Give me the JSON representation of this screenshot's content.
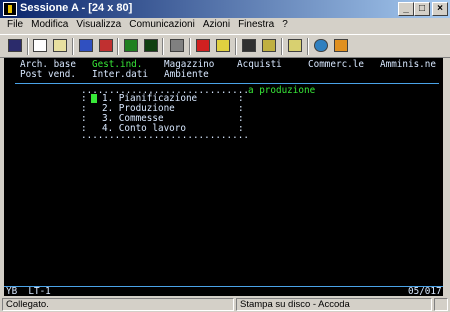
{
  "window": {
    "title": "Sessione A - [24 x 80]"
  },
  "menu": [
    "File",
    "Modifica",
    "Visualizza",
    "Comunicazioni",
    "Azioni",
    "Finestra",
    "?"
  ],
  "terminal": {
    "nav_row1": [
      {
        "label": "Arch. base",
        "active": false
      },
      {
        "label": "Gest.ind.",
        "active": true
      },
      {
        "label": "Magazzino",
        "active": false
      },
      {
        "label": "Acquisti",
        "active": false
      },
      {
        "label": "Commerc.le",
        "active": false
      },
      {
        "label": "Amminis.ne",
        "active": false
      }
    ],
    "nav_row2": [
      "Post vend.",
      "Inter.dati",
      "Ambiente"
    ],
    "popup_title": "a produzione",
    "popup_border_top": "..............................",
    "popup_items": [
      "1. Pianificazione",
      "2. Produzione",
      "3. Commesse",
      "4. Conto lavoro"
    ],
    "status_left": "YB  LT-1",
    "status_right": "05/017"
  },
  "status": {
    "connection": "Collegato.",
    "print": "Stampa su disco - Accoda"
  },
  "colors": {
    "active": "#38e838",
    "text": "#d8e8ff",
    "terminal_bg": "#000000"
  }
}
